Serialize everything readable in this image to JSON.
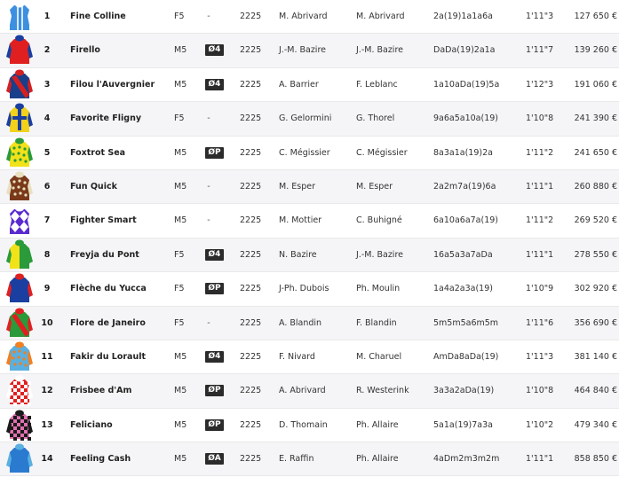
{
  "colors": {
    "row_alt": "#f5f5f7",
    "badge_bg": "#2b2b2b",
    "text": "#333333"
  },
  "runners": [
    {
      "num": "1",
      "name": "Fine Colline",
      "sexage": "F5",
      "shoe": "-",
      "dist": "2225",
      "driver": "M. Abrivard",
      "trainer": "M. Abrivard",
      "form": "2a(19)1a1a6a",
      "time": "1'11\"3",
      "gain": "127 650 €",
      "silk": {
        "c1": "#3d8fe0",
        "c2": "#ffffff",
        "pattern": "sleeves-stripes"
      }
    },
    {
      "num": "2",
      "name": "Firello",
      "sexage": "M5",
      "shoe": "Ø4",
      "dist": "2225",
      "driver": "J.-M. Bazire",
      "trainer": "J.-M. Bazire",
      "form": "DaDa(19)2a1a",
      "time": "1'11\"7",
      "gain": "139 260 €",
      "silk": {
        "c1": "#e02020",
        "c2": "#1a3fa0",
        "pattern": "plain"
      }
    },
    {
      "num": "3",
      "name": "Filou l'Auvergnier",
      "sexage": "M5",
      "shoe": "Ø4",
      "dist": "2225",
      "driver": "A. Barrier",
      "trainer": "F. Leblanc",
      "form": "1a10aDa(19)5a",
      "time": "1'12\"3",
      "gain": "191 060 €",
      "silk": {
        "c1": "#1a3f8a",
        "c2": "#d42020",
        "pattern": "sash"
      }
    },
    {
      "num": "4",
      "name": "Favorite Fligny",
      "sexage": "F5",
      "shoe": "-",
      "dist": "2225",
      "driver": "G. Gelormini",
      "trainer": "G. Thorel",
      "form": "9a6a5a10a(19)",
      "time": "1'10\"8",
      "gain": "241 390 €",
      "silk": {
        "c1": "#f2d21a",
        "c2": "#1a3fa0",
        "pattern": "cross"
      }
    },
    {
      "num": "5",
      "name": "Foxtrot Sea",
      "sexage": "M5",
      "shoe": "ØP",
      "dist": "2225",
      "driver": "C. Mégissier",
      "trainer": "C. Mégissier",
      "form": "8a3a1a(19)2a",
      "time": "1'11\"2",
      "gain": "241 650 €",
      "silk": {
        "c1": "#f2e21a",
        "c2": "#2a9a3a",
        "pattern": "dots"
      }
    },
    {
      "num": "6",
      "name": "Fun Quick",
      "sexage": "M5",
      "shoe": "-",
      "dist": "2225",
      "driver": "M. Esper",
      "trainer": "M. Esper",
      "form": "2a2m7a(19)6a",
      "time": "1'11\"1",
      "gain": "260 880 €",
      "silk": {
        "c1": "#7a3a1a",
        "c2": "#e8e0c0",
        "pattern": "dots"
      }
    },
    {
      "num": "7",
      "name": "Fighter Smart",
      "sexage": "M5",
      "shoe": "-",
      "dist": "2225",
      "driver": "M. Mottier",
      "trainer": "C. Buhigné",
      "form": "6a10a6a7a(19)",
      "time": "1'11\"2",
      "gain": "269 520 €",
      "silk": {
        "c1": "#5a2ad0",
        "c2": "#ffffff",
        "pattern": "diamonds"
      }
    },
    {
      "num": "8",
      "name": "Freyja du Pont",
      "sexage": "F5",
      "shoe": "Ø4",
      "dist": "2225",
      "driver": "N. Bazire",
      "trainer": "J.-M. Bazire",
      "form": "16a5a3a7aDa",
      "time": "1'11\"1",
      "gain": "278 550 €",
      "silk": {
        "c1": "#f2e21a",
        "c2": "#2a9a3a",
        "pattern": "halves"
      }
    },
    {
      "num": "9",
      "name": "Flèche du Yucca",
      "sexage": "F5",
      "shoe": "ØP",
      "dist": "2225",
      "driver": "J-Ph. Dubois",
      "trainer": "Ph. Moulin",
      "form": "1a4a2a3a(19)",
      "time": "1'10\"9",
      "gain": "302 920 €",
      "silk": {
        "c1": "#1a3fa0",
        "c2": "#e02020",
        "pattern": "plain"
      }
    },
    {
      "num": "10",
      "name": "Flore de Janeiro",
      "sexage": "F5",
      "shoe": "-",
      "dist": "2225",
      "driver": "A. Blandin",
      "trainer": "F. Blandin",
      "form": "5m5m5a6m5m",
      "time": "1'11\"6",
      "gain": "356 690 €",
      "silk": {
        "c1": "#2a9a3a",
        "c2": "#e02020",
        "pattern": "sash"
      }
    },
    {
      "num": "11",
      "name": "Fakir du Lorault",
      "sexage": "M5",
      "shoe": "Ø4",
      "dist": "2225",
      "driver": "F. Nivard",
      "trainer": "M. Charuel",
      "form": "AmDa8aDa(19)",
      "time": "1'11\"3",
      "gain": "381 140 €",
      "silk": {
        "c1": "#5ab0e0",
        "c2": "#f08020",
        "pattern": "dots"
      }
    },
    {
      "num": "12",
      "name": "Frisbee d'Am",
      "sexage": "M5",
      "shoe": "ØP",
      "dist": "2225",
      "driver": "A. Abrivard",
      "trainer": "R. Westerink",
      "form": "3a3a2aDa(19)",
      "time": "1'10\"8",
      "gain": "464 840 €",
      "silk": {
        "c1": "#e02020",
        "c2": "#ffffff",
        "pattern": "checks"
      }
    },
    {
      "num": "13",
      "name": "Feliciano",
      "sexage": "M5",
      "shoe": "ØP",
      "dist": "2225",
      "driver": "D. Thomain",
      "trainer": "Ph. Allaire",
      "form": "5a1a(19)7a3a",
      "time": "1'10\"2",
      "gain": "479 340 €",
      "silk": {
        "c1": "#e070b0",
        "c2": "#1a1a1a",
        "pattern": "checks"
      }
    },
    {
      "num": "14",
      "name": "Feeling Cash",
      "sexage": "M5",
      "shoe": "ØA",
      "dist": "2225",
      "driver": "E. Raffin",
      "trainer": "Ph. Allaire",
      "form": "4aDm2m3m2m",
      "time": "1'11\"1",
      "gain": "858 850 €",
      "silk": {
        "c1": "#2a7ad0",
        "c2": "#5ab0e0",
        "pattern": "plain"
      }
    }
  ]
}
